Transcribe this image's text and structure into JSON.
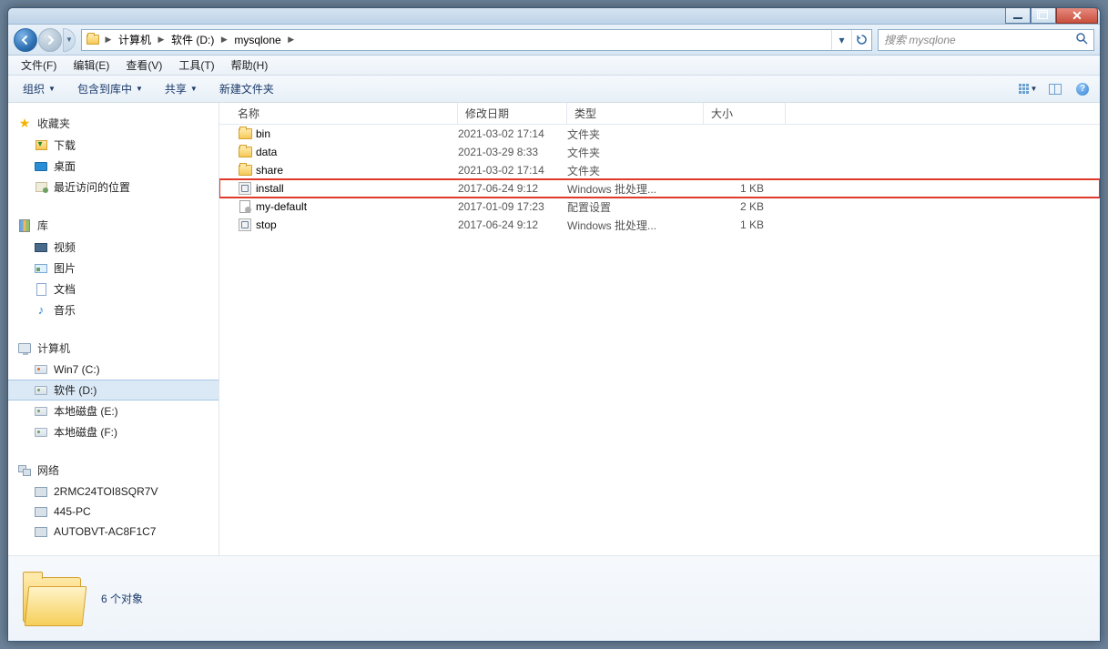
{
  "breadcrumb": {
    "computer": "计算机",
    "drive": "软件 (D:)",
    "folder": "mysqlone"
  },
  "search": {
    "placeholder": "搜索 mysqlone"
  },
  "menu": {
    "file": "文件(F)",
    "edit": "编辑(E)",
    "view": "查看(V)",
    "tools": "工具(T)",
    "help": "帮助(H)"
  },
  "toolbar": {
    "organize": "组织",
    "include": "包含到库中",
    "share": "共享",
    "newfolder": "新建文件夹"
  },
  "columns": {
    "name": "名称",
    "date": "修改日期",
    "type": "类型",
    "size": "大小"
  },
  "sidebar": {
    "favorites": "收藏夹",
    "downloads": "下载",
    "desktop": "桌面",
    "recent": "最近访问的位置",
    "libraries": "库",
    "videos": "视频",
    "pictures": "图片",
    "documents": "文档",
    "music": "音乐",
    "computer": "计算机",
    "drv_c": "Win7 (C:)",
    "drv_d": "软件 (D:)",
    "drv_e": "本地磁盘 (E:)",
    "drv_f": "本地磁盘 (F:)",
    "network": "网络",
    "net1": "2RMC24TOI8SQR7V",
    "net2": "445-PC",
    "net3": "AUTOBVT-AC8F1C7"
  },
  "files": [
    {
      "name": "bin",
      "date": "2021-03-02 17:14",
      "type": "文件夹",
      "size": "",
      "icon": "folder"
    },
    {
      "name": "data",
      "date": "2021-03-29 8:33",
      "type": "文件夹",
      "size": "",
      "icon": "folder"
    },
    {
      "name": "share",
      "date": "2021-03-02 17:14",
      "type": "文件夹",
      "size": "",
      "icon": "folder"
    },
    {
      "name": "install",
      "date": "2017-06-24 9:12",
      "type": "Windows 批处理...",
      "size": "1 KB",
      "icon": "bat",
      "highlight": true
    },
    {
      "name": "my-default",
      "date": "2017-01-09 17:23",
      "type": "配置设置",
      "size": "2 KB",
      "icon": "cfg"
    },
    {
      "name": "stop",
      "date": "2017-06-24 9:12",
      "type": "Windows 批处理...",
      "size": "1 KB",
      "icon": "bat"
    }
  ],
  "status": {
    "text": "6 个对象"
  }
}
